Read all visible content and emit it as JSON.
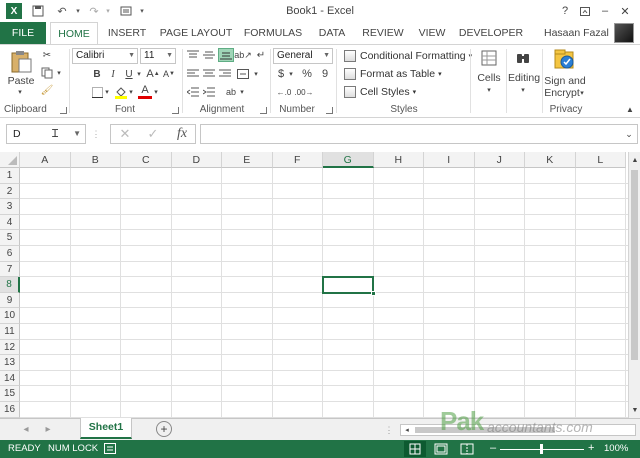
{
  "window": {
    "title": "Book1 - Excel",
    "help": "?",
    "minimize": "–",
    "close": "✕"
  },
  "ribbon_tabs": [
    {
      "label": "FILE"
    },
    {
      "label": "HOME"
    },
    {
      "label": "INSERT"
    },
    {
      "label": "PAGE LAYOUT"
    },
    {
      "label": "FORMULAS"
    },
    {
      "label": "DATA"
    },
    {
      "label": "REVIEW"
    },
    {
      "label": "VIEW"
    },
    {
      "label": "DEVELOPER"
    }
  ],
  "user": {
    "name": "Hasaan Fazal"
  },
  "ribbon": {
    "clipboard": {
      "paste": "Paste",
      "group": "Clipboard"
    },
    "font": {
      "name": "Calibri",
      "size": "11",
      "bold": "B",
      "italic": "I",
      "underline": "U",
      "grow": "A",
      "shrink": "A",
      "color": "A",
      "group": "Font"
    },
    "alignment": {
      "group": "Alignment"
    },
    "number": {
      "format": "General",
      "currency": "$",
      "percent": "%",
      "comma": "9",
      "group": "Number"
    },
    "styles": {
      "conditional": "Conditional Formatting",
      "format_table": "Format as Table",
      "cell_styles": "Cell Styles",
      "group": "Styles"
    },
    "cells": {
      "label": "Cells"
    },
    "editing": {
      "label": "Editing"
    },
    "privacy": {
      "sign": "Sign and",
      "encrypt": "Encrypt",
      "group": "Privacy"
    }
  },
  "formula_bar": {
    "name_box": "D",
    "fx": "fx",
    "cancel": "✕",
    "enter": "✓",
    "value": ""
  },
  "grid": {
    "columns": [
      "A",
      "B",
      "C",
      "D",
      "E",
      "F",
      "G",
      "H",
      "I",
      "J",
      "K",
      "L"
    ],
    "rows": [
      "1",
      "2",
      "3",
      "4",
      "5",
      "6",
      "7",
      "8",
      "9",
      "10",
      "11",
      "12",
      "13",
      "14",
      "15",
      "16"
    ],
    "active_cell": "G8"
  },
  "sheets": {
    "tabs": [
      {
        "label": "Sheet1"
      }
    ],
    "add": "+"
  },
  "status": {
    "ready": "READY",
    "num_lock": "NUM LOCK",
    "zoom": "100%",
    "zoom_minus": "–",
    "zoom_plus": "+"
  },
  "watermark": {
    "brand": "Pak",
    "site": "accountants.com"
  },
  "colors": {
    "accent": "#217346",
    "header_bg": "#f3f3f3",
    "grid_line": "#e0e0e0"
  }
}
